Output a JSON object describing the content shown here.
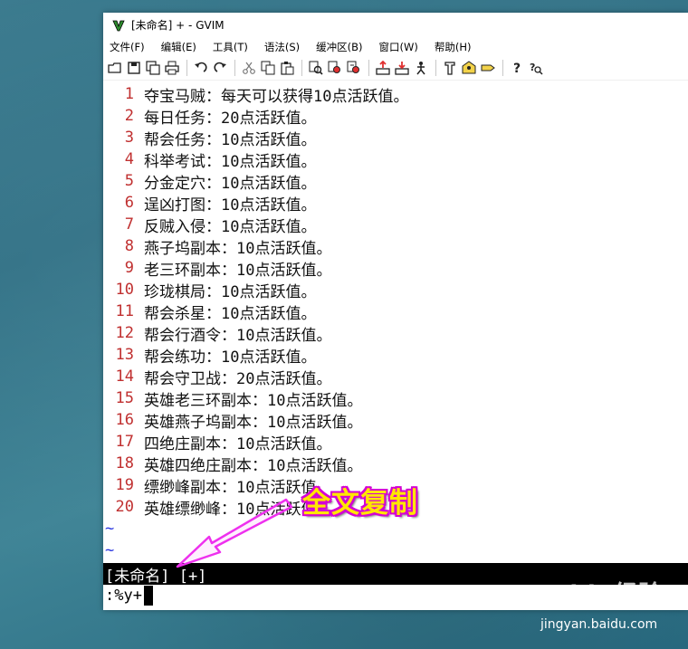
{
  "window": {
    "title": "[未命名] + - GVIM"
  },
  "menu": [
    "文件(F)",
    "编辑(E)",
    "工具(T)",
    "语法(S)",
    "缓冲区(B)",
    "窗口(W)",
    "帮助(H)"
  ],
  "editor": {
    "lines": [
      {
        "num": "1",
        "text": "夺宝马贼：每天可以获得10点活跃值。"
      },
      {
        "num": "2",
        "text": "每日任务：20点活跃值。"
      },
      {
        "num": "3",
        "text": "帮会任务：10点活跃值。"
      },
      {
        "num": "4",
        "text": "科举考试：10点活跃值。"
      },
      {
        "num": "5",
        "text": "分金定穴：10点活跃值。"
      },
      {
        "num": "6",
        "text": "逞凶打图：10点活跃值。"
      },
      {
        "num": "7",
        "text": "反贼入侵：10点活跃值。"
      },
      {
        "num": "8",
        "text": "燕子坞副本：10点活跃值。"
      },
      {
        "num": "9",
        "text": "老三环副本：10点活跃值。"
      },
      {
        "num": "10",
        "text": "珍珑棋局：10点活跃值。"
      },
      {
        "num": "11",
        "text": "帮会杀星：10点活跃值。"
      },
      {
        "num": "12",
        "text": "帮会行酒令：10点活跃值。"
      },
      {
        "num": "13",
        "text": "帮会练功：10点活跃值。"
      },
      {
        "num": "14",
        "text": "帮会守卫战：20点活跃值。"
      },
      {
        "num": "15",
        "text": "英雄老三环副本：10点活跃值。"
      },
      {
        "num": "16",
        "text": "英雄燕子坞副本：10点活跃值。"
      },
      {
        "num": "17",
        "text": "四绝庄副本：10点活跃值。"
      },
      {
        "num": "18",
        "text": "英雄四绝庄副本：10点活跃值。"
      },
      {
        "num": "19",
        "text": "缥缈峰副本：10点活跃值。"
      },
      {
        "num": "20",
        "text": "英雄缥缈峰：10点活跃值。"
      }
    ],
    "tildes": [
      "~",
      "~"
    ]
  },
  "status_line": "[未命名] [+]",
  "command_line": ":%y+",
  "annotation": "全文复制",
  "watermark": {
    "logo": "Baidu经验",
    "url": "jingyan.baidu.com"
  },
  "colors": {
    "line_number": "#c03030",
    "tilde": "#2a36e0",
    "annotation_fill": "#ffe600",
    "annotation_outline": "#d400d4",
    "arrow": "#ee30ee"
  }
}
